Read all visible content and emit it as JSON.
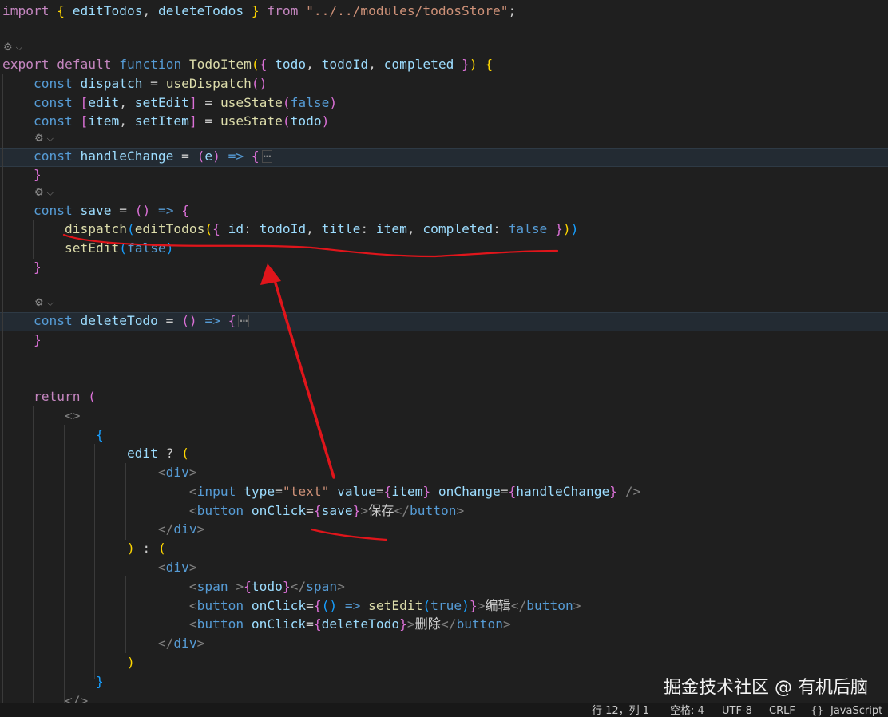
{
  "editor": {
    "codelens": [
      {
        "label": "⚙",
        "chevron": "⌵"
      },
      {
        "label": "⚙",
        "chevron": "⌵"
      },
      {
        "label": "⚙",
        "chevron": "⌵"
      },
      {
        "label": "⚙",
        "chevron": "⌵"
      }
    ],
    "fold_marker": "⋯",
    "lines": [
      [
        [
          "kw",
          "import"
        ],
        [
          "pl",
          " "
        ],
        [
          "p1",
          "{"
        ],
        [
          "pl",
          " "
        ],
        [
          "va",
          "editTodos"
        ],
        [
          "pl",
          ", "
        ],
        [
          "va",
          "deleteTodos"
        ],
        [
          "pl",
          " "
        ],
        [
          "p1",
          "}"
        ],
        [
          "pl",
          " "
        ],
        [
          "kw",
          "from"
        ],
        [
          "pl",
          " "
        ],
        [
          "str",
          "\"../../modules/todosStore\""
        ],
        [
          "pl",
          ";"
        ]
      ],
      [
        [
          "kw",
          "export"
        ],
        [
          "pl",
          " "
        ],
        [
          "kw",
          "default"
        ],
        [
          "pl",
          " "
        ],
        [
          "st",
          "function"
        ],
        [
          "pl",
          " "
        ],
        [
          "fn",
          "TodoItem"
        ],
        [
          "p1",
          "("
        ],
        [
          "p2",
          "{"
        ],
        [
          "pl",
          " "
        ],
        [
          "va",
          "todo"
        ],
        [
          "pl",
          ", "
        ],
        [
          "va",
          "todoId"
        ],
        [
          "pl",
          ", "
        ],
        [
          "va",
          "completed"
        ],
        [
          "pl",
          " "
        ],
        [
          "p2",
          "}"
        ],
        [
          "p1",
          ")"
        ],
        [
          "pl",
          " "
        ],
        [
          "p1",
          "{"
        ]
      ],
      [
        [
          "pl",
          "    "
        ],
        [
          "st",
          "const"
        ],
        [
          "pl",
          " "
        ],
        [
          "va",
          "dispatch"
        ],
        [
          "pl",
          " = "
        ],
        [
          "fn",
          "useDispatch"
        ],
        [
          "p2",
          "()"
        ]
      ],
      [
        [
          "pl",
          "    "
        ],
        [
          "st",
          "const"
        ],
        [
          "pl",
          " "
        ],
        [
          "p2",
          "["
        ],
        [
          "va",
          "edit"
        ],
        [
          "pl",
          ", "
        ],
        [
          "va",
          "setEdit"
        ],
        [
          "p2",
          "]"
        ],
        [
          "pl",
          " = "
        ],
        [
          "fn",
          "useState"
        ],
        [
          "p2",
          "("
        ],
        [
          "st",
          "false"
        ],
        [
          "p2",
          ")"
        ]
      ],
      [
        [
          "pl",
          "    "
        ],
        [
          "st",
          "const"
        ],
        [
          "pl",
          " "
        ],
        [
          "p2",
          "["
        ],
        [
          "va",
          "item"
        ],
        [
          "pl",
          ", "
        ],
        [
          "va",
          "setItem"
        ],
        [
          "p2",
          "]"
        ],
        [
          "pl",
          " = "
        ],
        [
          "fn",
          "useState"
        ],
        [
          "p2",
          "("
        ],
        [
          "va",
          "todo"
        ],
        [
          "p2",
          ")"
        ]
      ],
      [
        [
          "pl",
          "    "
        ],
        [
          "st",
          "const"
        ],
        [
          "pl",
          " "
        ],
        [
          "va",
          "handleChange"
        ],
        [
          "pl",
          " = "
        ],
        [
          "p2",
          "("
        ],
        [
          "va",
          "e"
        ],
        [
          "p2",
          ")"
        ],
        [
          "pl",
          " "
        ],
        [
          "st",
          "=>"
        ],
        [
          "pl",
          " "
        ],
        [
          "p2",
          "{"
        ]
      ],
      [
        [
          "pl",
          "    "
        ],
        [
          "p2",
          "}"
        ]
      ],
      [
        [
          "pl",
          "    "
        ],
        [
          "st",
          "const"
        ],
        [
          "pl",
          " "
        ],
        [
          "va",
          "save"
        ],
        [
          "pl",
          " = "
        ],
        [
          "p2",
          "()"
        ],
        [
          "pl",
          " "
        ],
        [
          "st",
          "=>"
        ],
        [
          "pl",
          " "
        ],
        [
          "p2",
          "{"
        ]
      ],
      [
        [
          "pl",
          "        "
        ],
        [
          "fn",
          "dispatch"
        ],
        [
          "p3",
          "("
        ],
        [
          "fn",
          "editTodos"
        ],
        [
          "p1",
          "("
        ],
        [
          "p2",
          "{"
        ],
        [
          "pl",
          " "
        ],
        [
          "va",
          "id"
        ],
        [
          "pl",
          ": "
        ],
        [
          "va",
          "todoId"
        ],
        [
          "pl",
          ", "
        ],
        [
          "va",
          "title"
        ],
        [
          "pl",
          ": "
        ],
        [
          "va",
          "item"
        ],
        [
          "pl",
          ", "
        ],
        [
          "va",
          "completed"
        ],
        [
          "pl",
          ": "
        ],
        [
          "st",
          "false"
        ],
        [
          "pl",
          " "
        ],
        [
          "p2",
          "}"
        ],
        [
          "p1",
          ")"
        ],
        [
          "p3",
          ")"
        ]
      ],
      [
        [
          "pl",
          "        "
        ],
        [
          "fn",
          "setEdit"
        ],
        [
          "p3",
          "("
        ],
        [
          "st",
          "false"
        ],
        [
          "p3",
          ")"
        ]
      ],
      [
        [
          "pl",
          "    "
        ],
        [
          "p2",
          "}"
        ]
      ],
      [
        [
          "pl",
          "    "
        ],
        [
          "st",
          "const"
        ],
        [
          "pl",
          " "
        ],
        [
          "va",
          "deleteTodo"
        ],
        [
          "pl",
          " = "
        ],
        [
          "p2",
          "()"
        ],
        [
          "pl",
          " "
        ],
        [
          "st",
          "=>"
        ],
        [
          "pl",
          " "
        ],
        [
          "p2",
          "{"
        ]
      ],
      [
        [
          "pl",
          "    "
        ],
        [
          "p2",
          "}"
        ]
      ],
      [
        [
          "pl",
          "    "
        ],
        [
          "kw",
          "return"
        ],
        [
          "pl",
          " "
        ],
        [
          "p2",
          "("
        ]
      ],
      [
        [
          "pl",
          "        "
        ],
        [
          "tg",
          "<>"
        ]
      ],
      [
        [
          "pl",
          "            "
        ],
        [
          "p3",
          "{"
        ]
      ],
      [
        [
          "pl",
          "                "
        ],
        [
          "va",
          "edit"
        ],
        [
          "pl",
          " ? "
        ],
        [
          "p1",
          "("
        ]
      ],
      [
        [
          "pl",
          "                    "
        ],
        [
          "tg",
          "<"
        ],
        [
          "st",
          "div"
        ],
        [
          "tg",
          ">"
        ]
      ],
      [
        [
          "pl",
          "                        "
        ],
        [
          "tg",
          "<"
        ],
        [
          "st",
          "input"
        ],
        [
          "pl",
          " "
        ],
        [
          "va",
          "type"
        ],
        [
          "pl",
          "="
        ],
        [
          "str",
          "\"text\""
        ],
        [
          "pl",
          " "
        ],
        [
          "va",
          "value"
        ],
        [
          "pl",
          "="
        ],
        [
          "p2",
          "{"
        ],
        [
          "va",
          "item"
        ],
        [
          "p2",
          "}"
        ],
        [
          "pl",
          " "
        ],
        [
          "va",
          "onChange"
        ],
        [
          "pl",
          "="
        ],
        [
          "p2",
          "{"
        ],
        [
          "va",
          "handleChange"
        ],
        [
          "p2",
          "}"
        ],
        [
          "pl",
          " "
        ],
        [
          "tg",
          "/>"
        ]
      ],
      [
        [
          "pl",
          "                        "
        ],
        [
          "tg",
          "<"
        ],
        [
          "st",
          "button"
        ],
        [
          "pl",
          " "
        ],
        [
          "va",
          "onClick"
        ],
        [
          "pl",
          "="
        ],
        [
          "p2",
          "{"
        ],
        [
          "va",
          "save"
        ],
        [
          "p2",
          "}"
        ],
        [
          "tg",
          ">"
        ],
        [
          "pl",
          "保存"
        ],
        [
          "tg",
          "</"
        ],
        [
          "st",
          "button"
        ],
        [
          "tg",
          ">"
        ]
      ],
      [
        [
          "pl",
          "                    "
        ],
        [
          "tg",
          "</"
        ],
        [
          "st",
          "div"
        ],
        [
          "tg",
          ">"
        ]
      ],
      [
        [
          "pl",
          "                "
        ],
        [
          "p1",
          ")"
        ],
        [
          "pl",
          " : "
        ],
        [
          "p1",
          "("
        ]
      ],
      [
        [
          "pl",
          "                    "
        ],
        [
          "tg",
          "<"
        ],
        [
          "st",
          "div"
        ],
        [
          "tg",
          ">"
        ]
      ],
      [
        [
          "pl",
          "                        "
        ],
        [
          "tg",
          "<"
        ],
        [
          "st",
          "span"
        ],
        [
          "pl",
          " "
        ],
        [
          "tg",
          ">"
        ],
        [
          "p2",
          "{"
        ],
        [
          "va",
          "todo"
        ],
        [
          "p2",
          "}"
        ],
        [
          "tg",
          "</"
        ],
        [
          "st",
          "span"
        ],
        [
          "tg",
          ">"
        ]
      ],
      [
        [
          "pl",
          "                        "
        ],
        [
          "tg",
          "<"
        ],
        [
          "st",
          "button"
        ],
        [
          "pl",
          " "
        ],
        [
          "va",
          "onClick"
        ],
        [
          "pl",
          "="
        ],
        [
          "p2",
          "{"
        ],
        [
          "p3",
          "()"
        ],
        [
          "pl",
          " "
        ],
        [
          "st",
          "=>"
        ],
        [
          "pl",
          " "
        ],
        [
          "fn",
          "setEdit"
        ],
        [
          "p3",
          "("
        ],
        [
          "st",
          "true"
        ],
        [
          "p3",
          ")"
        ],
        [
          "p2",
          "}"
        ],
        [
          "tg",
          ">"
        ],
        [
          "pl",
          "编辑"
        ],
        [
          "tg",
          "</"
        ],
        [
          "st",
          "button"
        ],
        [
          "tg",
          ">"
        ]
      ],
      [
        [
          "pl",
          "                        "
        ],
        [
          "tg",
          "<"
        ],
        [
          "st",
          "button"
        ],
        [
          "pl",
          " "
        ],
        [
          "va",
          "onClick"
        ],
        [
          "pl",
          "="
        ],
        [
          "p2",
          "{"
        ],
        [
          "va",
          "deleteTodo"
        ],
        [
          "p2",
          "}"
        ],
        [
          "tg",
          ">"
        ],
        [
          "pl",
          "删除"
        ],
        [
          "tg",
          "</"
        ],
        [
          "st",
          "button"
        ],
        [
          "tg",
          ">"
        ]
      ],
      [
        [
          "pl",
          "                    "
        ],
        [
          "tg",
          "</"
        ],
        [
          "st",
          "div"
        ],
        [
          "tg",
          ">"
        ]
      ],
      [
        [
          "pl",
          "                "
        ],
        [
          "p1",
          ")"
        ]
      ],
      [
        [
          "pl",
          "            "
        ],
        [
          "p3",
          "}"
        ]
      ],
      [
        [
          "pl",
          "        "
        ],
        [
          "tg",
          "</>"
        ]
      ]
    ]
  },
  "statusbar": {
    "position": "行 12，列 1",
    "spaces": "空格: 4",
    "encoding": "UTF-8",
    "eol": "CRLF",
    "language_icon": "{}",
    "language": "JavaScript"
  },
  "watermark": "掘金技术社区 @ 有机后脑",
  "colors": {
    "editor_bg": "#1f1f1f",
    "annotation_red": "#e0151b",
    "keyword": "#c586c0",
    "storage": "#569cd6",
    "function": "#dcdcaa",
    "variable": "#9cdcfe",
    "string": "#ce9178"
  }
}
